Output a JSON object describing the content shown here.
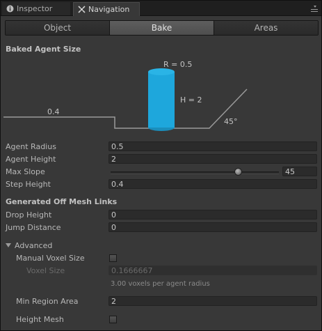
{
  "tabs": [
    {
      "label": "Inspector",
      "icon": "info-icon"
    },
    {
      "label": "Navigation",
      "icon": "navigation-icon"
    }
  ],
  "modes": [
    "Object",
    "Bake",
    "Areas"
  ],
  "active_mode": "Bake",
  "baked_agent_size": {
    "title": "Baked Agent Size",
    "radius_label": "R = 0.5",
    "height_label": "H = 2",
    "step_label": "0.4",
    "slope_label": "45°"
  },
  "properties": {
    "agent_radius": {
      "label": "Agent Radius",
      "value": "0.5"
    },
    "agent_height": {
      "label": "Agent Height",
      "value": "2"
    },
    "max_slope": {
      "label": "Max Slope",
      "value": "45",
      "fraction": 0.758
    },
    "step_height": {
      "label": "Step Height",
      "value": "0.4"
    }
  },
  "offmesh": {
    "title": "Generated Off Mesh Links",
    "drop_height": {
      "label": "Drop Height",
      "value": "0"
    },
    "jump_distance": {
      "label": "Jump Distance",
      "value": "0"
    }
  },
  "advanced": {
    "label": "Advanced",
    "manual_voxel_size": {
      "label": "Manual Voxel Size",
      "checked": false
    },
    "voxel_size": {
      "label": "Voxel Size",
      "value": "0.1666667",
      "hint": "3.00 voxels per agent radius"
    },
    "min_region_area": {
      "label": "Min Region Area",
      "value": "2"
    },
    "height_mesh": {
      "label": "Height Mesh",
      "checked": false
    }
  },
  "colors": {
    "agent_cylinder": "#1ea7dc",
    "active_tab": "#555555"
  }
}
